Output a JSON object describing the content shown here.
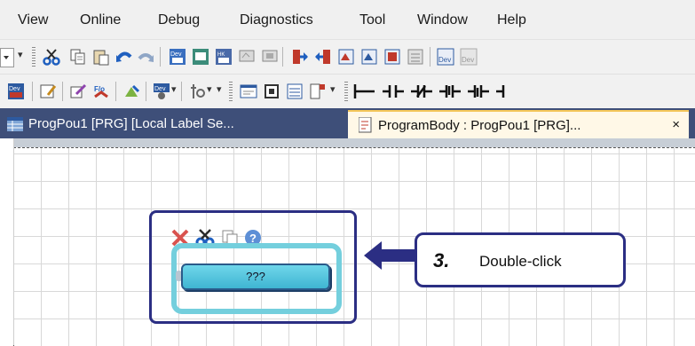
{
  "menubar": {
    "items": [
      "View",
      "Online",
      "Debug",
      "Diagnostics",
      "Tool",
      "Window",
      "Help"
    ]
  },
  "toolbar1": {
    "icons": [
      "dropdown-icon",
      "cut-icon",
      "copy-icon",
      "paste-icon",
      "undo-icon",
      "redo-icon",
      "dev-read-icon",
      "dev-write-icon",
      "dev-verify-icon",
      "monitor-icon",
      "monitor-stop-icon",
      "write-to-plc-icon",
      "read-from-plc-icon",
      "search-icon",
      "replace-icon",
      "cross-reference-icon",
      "device-list-icon",
      "dev-icon"
    ]
  },
  "toolbar2": {
    "icons": [
      "device-batch-icon",
      "edit-icon",
      "pen-icon",
      "convert-icon",
      "online-change-icon",
      "watch-icon",
      "find-icon",
      "window-icon",
      "frame-icon",
      "list-icon",
      "label-icon",
      "ladder-open-contact-icon",
      "ladder-closed-contact-icon",
      "ladder-rising-icon",
      "ladder-falling-icon"
    ]
  },
  "tabs": [
    {
      "label": "ProgPou1 [PRG] [Local Label Se...",
      "active": false
    },
    {
      "label": "ProgramBody : ProgPou1 [PRG]...",
      "active": true,
      "close": "×"
    }
  ],
  "canvas": {
    "mini_toolbar": [
      "delete-icon",
      "cut-icon",
      "copy-icon",
      "help-icon"
    ],
    "function_block": {
      "label": "???"
    }
  },
  "callout": {
    "step": "3.",
    "text": "Double-click"
  },
  "colors": {
    "menubar_bg": "#f0f0f0",
    "tabbar_bg": "#3e4f79",
    "active_tab_accent": "#f5c75a",
    "callout_border": "#2b2e83",
    "highlight_cyan": "#74cfdd",
    "fb_fill": "#3fb5d2"
  }
}
